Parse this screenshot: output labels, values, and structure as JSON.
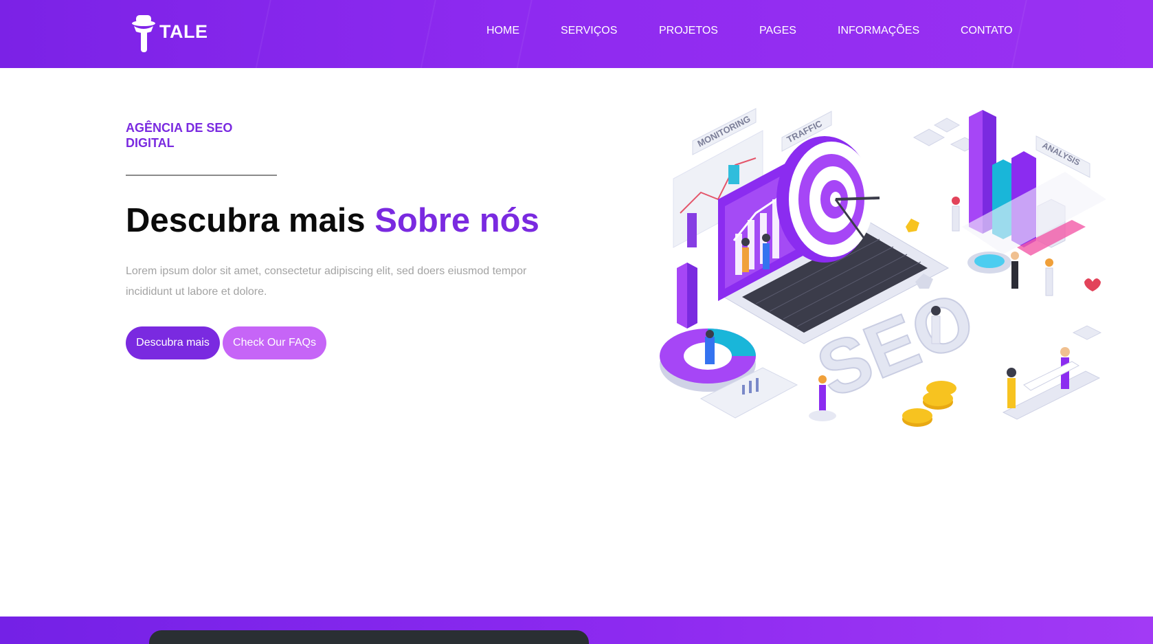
{
  "brand": {
    "name": "TALE"
  },
  "nav": {
    "items": [
      "HOME",
      "SERVIÇOS",
      "PROJETOS",
      "PAGES",
      "INFORMAÇÕES",
      "CONTATO"
    ]
  },
  "hero": {
    "eyebrow_line1": "AGÊNCIA DE SEO",
    "eyebrow_line2": "DIGITAL",
    "headline_main": "Descubra mais ",
    "headline_accent": "Sobre nós",
    "lead": "Lorem ipsum dolor sit amet, consectetur adipiscing elit, sed doers eiusmod tempor incididunt ut labore et dolore.",
    "primary_button": "Descubra mais",
    "secondary_button": "Check Our FAQs"
  },
  "illustration": {
    "labels": [
      "MONITORING",
      "TRAFFIC",
      "ANALYSIS",
      "SEO"
    ]
  },
  "colors": {
    "brand_purple": "#7a2ae0",
    "button_pink": "#c665f7",
    "text_dark": "#0b0b0b",
    "text_muted": "#a3a3a3"
  }
}
